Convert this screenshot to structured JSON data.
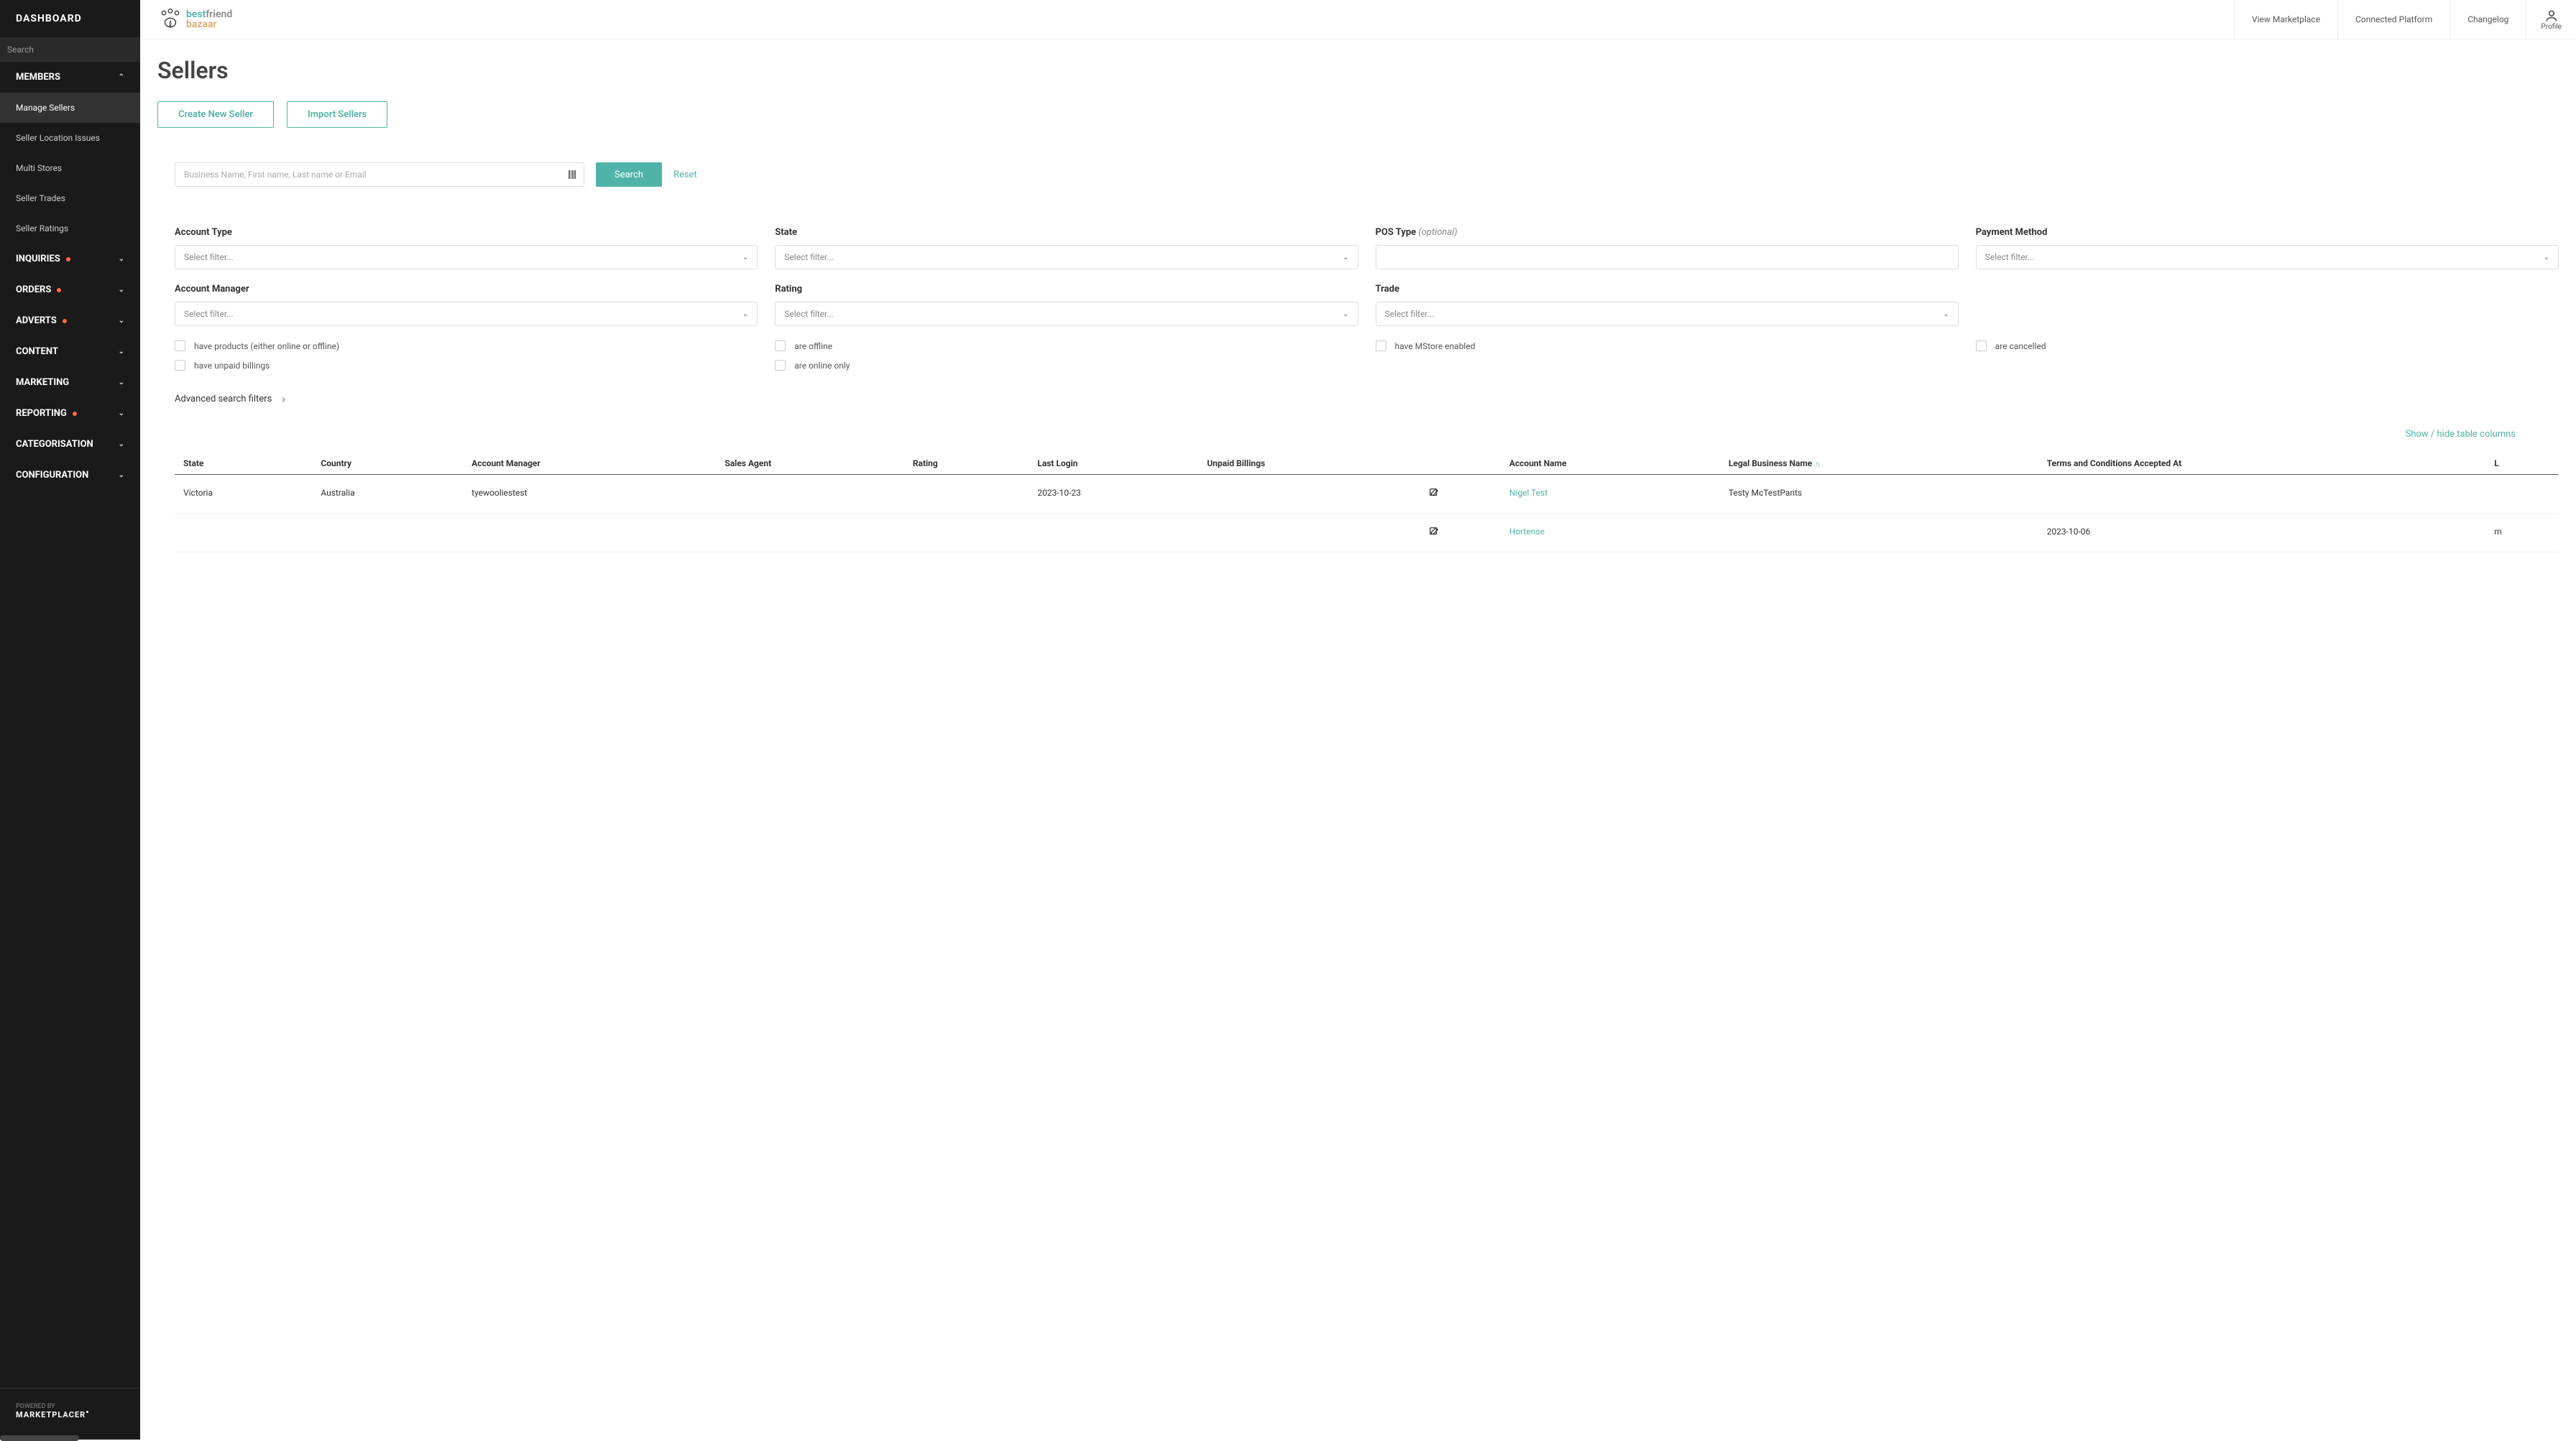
{
  "sidebar": {
    "title": "DASHBOARD",
    "search_placeholder": "Search",
    "sections": {
      "members": {
        "label": "MEMBERS",
        "expanded": true
      },
      "inquiries": {
        "label": "INQUIRIES",
        "dot": true
      },
      "orders": {
        "label": "ORDERS",
        "dot": true
      },
      "adverts": {
        "label": "ADVERTS",
        "dot": true
      },
      "content": {
        "label": "CONTENT"
      },
      "marketing": {
        "label": "MARKETING"
      },
      "reporting": {
        "label": "REPORTING",
        "dot": true
      },
      "categorisation": {
        "label": "CATEGORISATION"
      },
      "configuration": {
        "label": "CONFIGURATION"
      }
    },
    "members_items": [
      "Manage Sellers",
      "Seller Location Issues",
      "Multi Stores",
      "Seller Trades",
      "Seller Ratings"
    ],
    "footer_powered": "POWERED BY",
    "footer_brand": "MARKETPLACER"
  },
  "topbar": {
    "logo_line1a": "best",
    "logo_line1b": "friend",
    "logo_line2": "bazaar",
    "links": [
      "View Marketplace",
      "Connected Platform",
      "Changelog"
    ],
    "profile": "Profile"
  },
  "page": {
    "title": "Sellers",
    "create_btn": "Create New Seller",
    "import_btn": "Import Sellers",
    "search_placeholder": "Business Name, First name, Last name or Email",
    "search_btn": "Search",
    "reset": "Reset",
    "filters": {
      "account_type": {
        "label": "Account Type",
        "value": "Select filter..."
      },
      "state": {
        "label": "State",
        "value": "Select filter..."
      },
      "pos_type": {
        "label": "POS Type",
        "optional": "(optional)",
        "value": ""
      },
      "payment_method": {
        "label": "Payment Method",
        "value": "Select filter..."
      },
      "account_manager": {
        "label": "Account Manager",
        "value": "Select filter..."
      },
      "rating": {
        "label": "Rating",
        "value": "Select filter..."
      },
      "trade": {
        "label": "Trade",
        "value": "Select filter..."
      }
    },
    "checkboxes": {
      "have_products": "have products (either online or offline)",
      "are_offline": "are offline",
      "have_mstore": "have MStore enabled",
      "are_cancelled": "are cancelled",
      "have_unpaid": "have unpaid billings",
      "are_online": "are online only"
    },
    "advanced": "Advanced search filters",
    "show_hide": "Show / hide table columns"
  },
  "table": {
    "columns": [
      "State",
      "Country",
      "Account Manager",
      "Sales Agent",
      "Rating",
      "Last Login",
      "Unpaid Billings",
      "",
      "Account Name",
      "Legal Business Name",
      "Terms and Conditions Accepted At",
      "L"
    ],
    "sort_col": "Legal Business Name",
    "rows": [
      {
        "state": "Victoria",
        "country": "Australia",
        "account_manager": "tyewooliestest",
        "sales_agent": "",
        "rating": "",
        "last_login": "2023-10-23",
        "unpaid_billings": "",
        "account_name": "Nigel Test",
        "legal_business_name": "Testy McTestPants",
        "terms_accepted": "",
        "extra": ""
      },
      {
        "state": "",
        "country": "",
        "account_manager": "",
        "sales_agent": "",
        "rating": "",
        "last_login": "",
        "unpaid_billings": "",
        "account_name": "Hortense",
        "legal_business_name": "",
        "terms_accepted": "2023-10-06",
        "extra": "m"
      }
    ]
  }
}
